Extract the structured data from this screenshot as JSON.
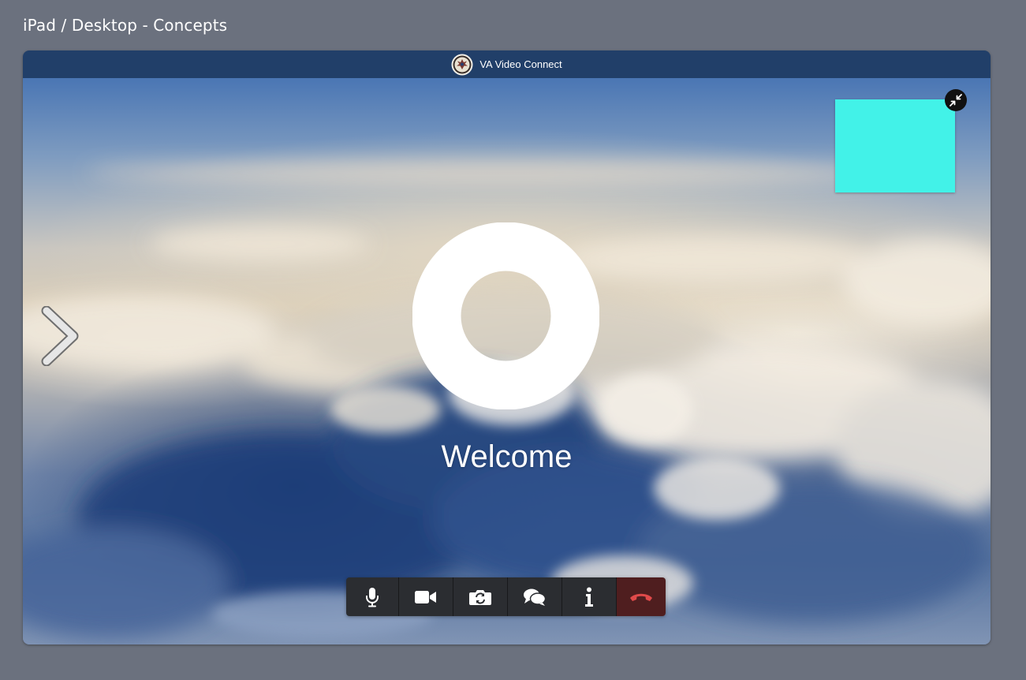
{
  "page": {
    "title": "iPad / Desktop - Concepts"
  },
  "window": {
    "app_name": "VA Video Connect",
    "logo_icon": "va-seal-icon"
  },
  "video": {
    "welcome_text": "Welcome",
    "next_icon": "chevron-right-icon",
    "loading_icon": "ring-icon",
    "self_view_color": "#42f2e8",
    "minimize_icon": "minimize-icon"
  },
  "toolbar": {
    "buttons": [
      {
        "name": "microphone",
        "icon": "microphone-icon"
      },
      {
        "name": "camera",
        "icon": "video-camera-icon"
      },
      {
        "name": "switch-camera",
        "icon": "camera-switch-icon"
      },
      {
        "name": "chat",
        "icon": "chat-bubbles-icon"
      },
      {
        "name": "info",
        "icon": "info-icon"
      },
      {
        "name": "hang-up",
        "icon": "phone-hangup-icon"
      }
    ],
    "hangup_color": "#4f1e1f",
    "hangup_icon_color": "#e04a4a"
  },
  "colors": {
    "background": "#6b717e",
    "titlebar": "#213f69"
  }
}
